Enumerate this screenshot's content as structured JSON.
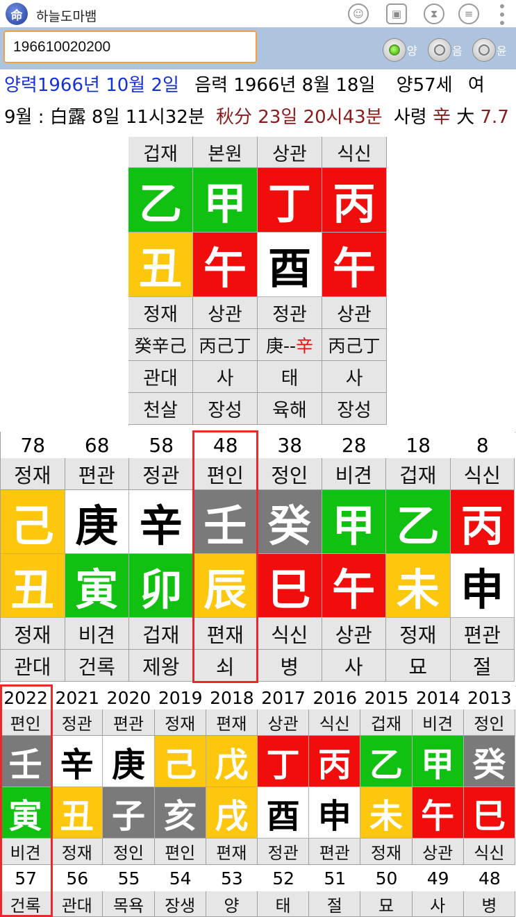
{
  "app": {
    "title": "하늘도마뱀",
    "icon_char": "命"
  },
  "toolbar": {
    "icons": [
      "add-user-icon",
      "save-icon",
      "hourglass-icon",
      "database-icon",
      "more-icon"
    ]
  },
  "input": {
    "value": "196610020200"
  },
  "radios": [
    {
      "label": "양",
      "selected": true
    },
    {
      "label": "음",
      "selected": false
    },
    {
      "label": "윤",
      "selected": false
    }
  ],
  "info": {
    "solar": "양력1966년 10월 2일",
    "lunar": "음력 1966년 8월 18일",
    "age": "양57세",
    "gender": "여",
    "month": "9월 : 白露 8일 11시32분",
    "term": "秋分 23일 20시43분",
    "saryeong_label": "사령",
    "saryeong_char": "辛",
    "daeun_char": "大",
    "daeun_num": "7.7"
  },
  "colors": {
    "green": "#11c111",
    "red": "#f20d0d",
    "yellow": "#fcc70c",
    "white": "#ffffff",
    "gray": "#7a7a7a",
    "highlight": "#ea2a2a"
  },
  "pillars": {
    "top_labels": [
      "겁재",
      "본원",
      "상관",
      "식신"
    ],
    "stems": [
      {
        "c": "乙",
        "col": "g"
      },
      {
        "c": "甲",
        "col": "g"
      },
      {
        "c": "丁",
        "col": "r"
      },
      {
        "c": "丙",
        "col": "r"
      }
    ],
    "branches": [
      {
        "c": "丑",
        "col": "y"
      },
      {
        "c": "午",
        "col": "r"
      },
      {
        "c": "酉",
        "col": "w"
      },
      {
        "c": "午",
        "col": "r"
      }
    ],
    "branch_labels": [
      "정재",
      "상관",
      "정관",
      "상관"
    ],
    "hidden": [
      "癸辛己",
      "丙己丁",
      "庚-- ",
      "丙己丁"
    ],
    "hidden_extra": "辛",
    "stages": [
      "관대",
      "사",
      "태",
      "사"
    ],
    "spirits": [
      "천살",
      "장성",
      "육해",
      "장성"
    ]
  },
  "daeun": {
    "ages": [
      "78",
      "68",
      "58",
      "48",
      "38",
      "28",
      "18",
      "8"
    ],
    "stem_labels": [
      "정재",
      "편관",
      "정관",
      "편인",
      "정인",
      "비견",
      "겁재",
      "식신"
    ],
    "stems": [
      {
        "c": "己",
        "col": "y"
      },
      {
        "c": "庚",
        "col": "w"
      },
      {
        "c": "辛",
        "col": "w"
      },
      {
        "c": "壬",
        "col": "k"
      },
      {
        "c": "癸",
        "col": "k"
      },
      {
        "c": "甲",
        "col": "g"
      },
      {
        "c": "乙",
        "col": "g"
      },
      {
        "c": "丙",
        "col": "r"
      }
    ],
    "branches": [
      {
        "c": "丑",
        "col": "y"
      },
      {
        "c": "寅",
        "col": "g"
      },
      {
        "c": "卯",
        "col": "g"
      },
      {
        "c": "辰",
        "col": "y"
      },
      {
        "c": "巳",
        "col": "r"
      },
      {
        "c": "午",
        "col": "r"
      },
      {
        "c": "未",
        "col": "y"
      },
      {
        "c": "申",
        "col": "w"
      }
    ],
    "branch_labels": [
      "정재",
      "비견",
      "겁재",
      "편재",
      "식신",
      "상관",
      "정재",
      "편관"
    ],
    "stages": [
      "관대",
      "건록",
      "제왕",
      "쇠",
      "병",
      "사",
      "묘",
      "절"
    ],
    "selected": 3
  },
  "yearly": {
    "years": [
      "2022",
      "2021",
      "2020",
      "2019",
      "2018",
      "2017",
      "2016",
      "2015",
      "2014",
      "2013"
    ],
    "stem_labels": [
      "편인",
      "정관",
      "편관",
      "정재",
      "편재",
      "상관",
      "식신",
      "겁재",
      "비견",
      "정인"
    ],
    "stems": [
      {
        "c": "壬",
        "col": "k"
      },
      {
        "c": "辛",
        "col": "w"
      },
      {
        "c": "庚",
        "col": "w"
      },
      {
        "c": "己",
        "col": "y"
      },
      {
        "c": "戊",
        "col": "y"
      },
      {
        "c": "丁",
        "col": "r"
      },
      {
        "c": "丙",
        "col": "r"
      },
      {
        "c": "乙",
        "col": "g"
      },
      {
        "c": "甲",
        "col": "g"
      },
      {
        "c": "癸",
        "col": "k"
      }
    ],
    "branches": [
      {
        "c": "寅",
        "col": "g"
      },
      {
        "c": "丑",
        "col": "y"
      },
      {
        "c": "子",
        "col": "k"
      },
      {
        "c": "亥",
        "col": "k"
      },
      {
        "c": "戌",
        "col": "y"
      },
      {
        "c": "酉",
        "col": "w"
      },
      {
        "c": "申",
        "col": "w"
      },
      {
        "c": "未",
        "col": "y"
      },
      {
        "c": "午",
        "col": "r"
      },
      {
        "c": "巳",
        "col": "r"
      }
    ],
    "branch_labels": [
      "비견",
      "정재",
      "정인",
      "편인",
      "편재",
      "정관",
      "편관",
      "정재",
      "상관",
      "식신"
    ],
    "ages": [
      "57",
      "56",
      "55",
      "54",
      "53",
      "52",
      "51",
      "50",
      "49",
      "48"
    ],
    "stages": [
      "건록",
      "관대",
      "목욕",
      "장생",
      "양",
      "태",
      "절",
      "묘",
      "사",
      "병"
    ],
    "selected": 0
  }
}
